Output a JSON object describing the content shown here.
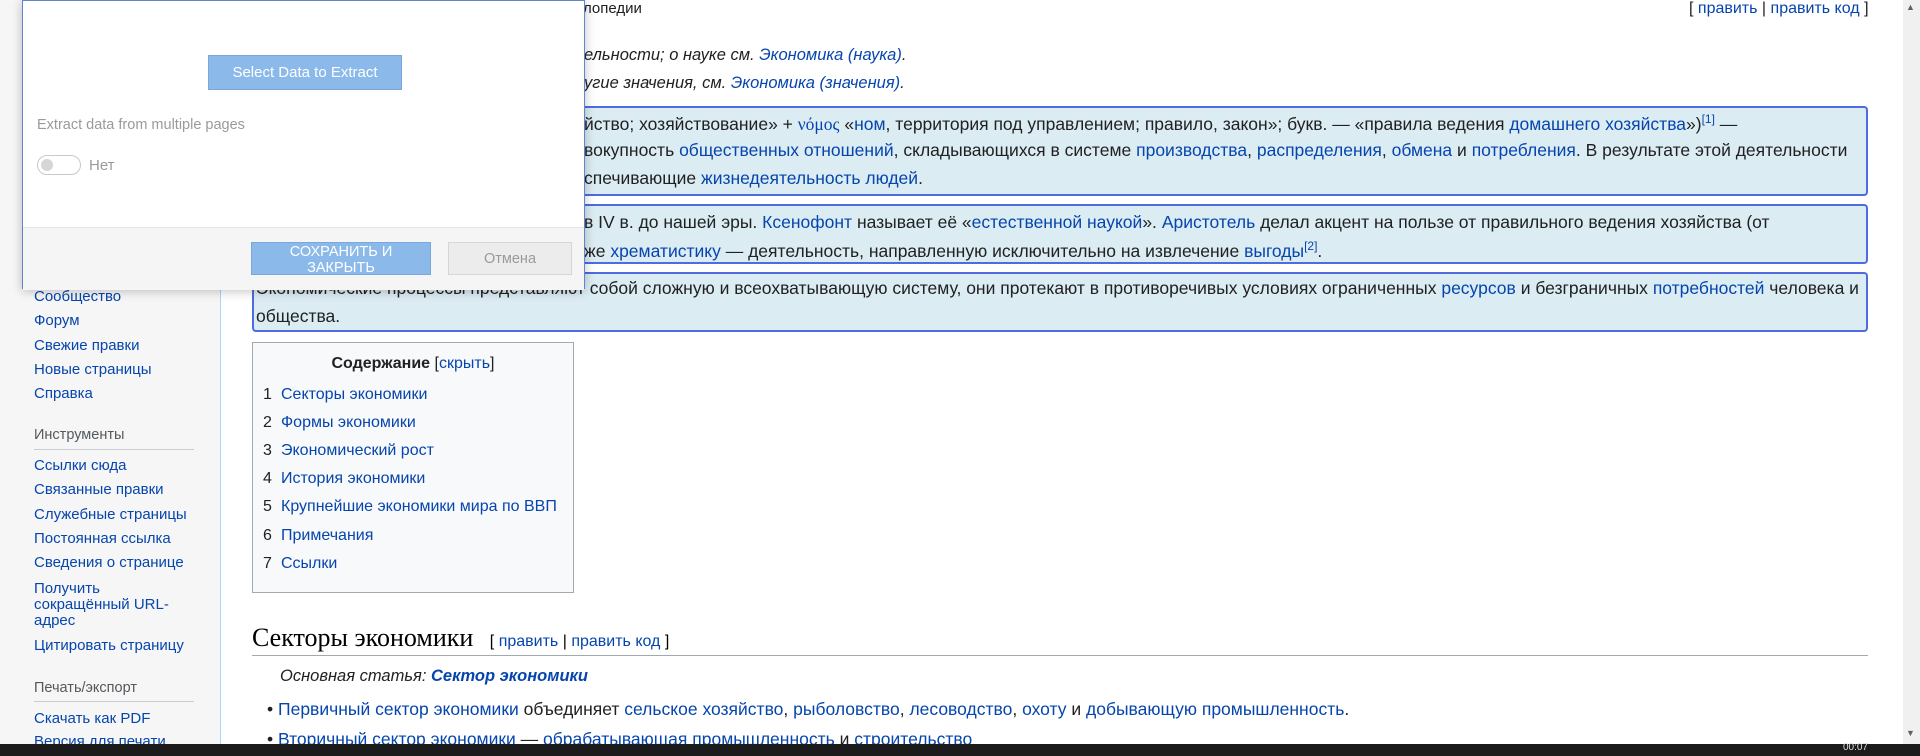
{
  "sidebar": {
    "participation_links": [
      "Сообщество",
      "Форум",
      "Свежие правки",
      "Новые страницы",
      "Справка"
    ],
    "tools_heading": "Инструменты",
    "tools_links": [
      "Ссылки сюда",
      "Связанные правки",
      "Служебные страницы",
      "Постоянная ссылка",
      "Сведения о странице"
    ],
    "short_url_lines": [
      "Получить",
      "сокращённый URL-",
      "адрес"
    ],
    "cite_link": "Цитировать страницу",
    "print_heading": "Печать/экспорт",
    "print_links": [
      "Скачать как PDF",
      "Версия для печати"
    ]
  },
  "article": {
    "subtitle_partial": "лопедии",
    "top_edit": {
      "open": "[",
      "edit": "править",
      "sep": "|",
      "edit_code": "править код",
      "close": "]"
    },
    "hatnote1": {
      "pre": "ельности; о науке см.",
      "link": "Экономика (наука)",
      "post": "."
    },
    "hatnote2": {
      "pre": "угие значения, см.",
      "link": "Экономика (значения)",
      "post": "."
    },
    "p1": {
      "l1_a": "йство; хозяйствование» +",
      "l1_greek": "νόμος",
      "l1_b": "«",
      "l1_link1": "ном",
      "l1_c": ", территория под управлением; правило, закон»; букв. — «правила ведения",
      "l1_link2": "домашнего хозяйства",
      "l1_d": "»)",
      "l1_sup": "[1]",
      "l1_e": " —",
      "l2_a": "вокупность",
      "l2_link1": "общественных отношений",
      "l2_b": ", складывающихся в системе",
      "l2_link2": "производства",
      "l2_c": ",",
      "l2_link3": "распределения",
      "l2_d": ",",
      "l2_link4": "обмена",
      "l2_e": "и",
      "l2_link5": "потребления",
      "l2_f": ". В результате этой деятельности",
      "l3_a": "спечивающие",
      "l3_link": "жизнедеятельность людей",
      "l3_b": "."
    },
    "p2": {
      "l1_a": "в IV в. до нашей эры.",
      "l1_link1": "Ксенофонт",
      "l1_b": "называет её «",
      "l1_link2": "естественной наукой",
      "l1_c": "».",
      "l1_link3": "Аристотель",
      "l1_d": "делал акцент на пользе от правильного ведения хозяйства (от",
      "l2_a": "же",
      "l2_link1": "хрематистику",
      "l2_b": "— деятельность, направленную исключительно на извлечение",
      "l2_link2": "выгоды",
      "l2_sup": "[2]",
      "l2_c": "."
    },
    "p3": {
      "l1_a": "Экономические процессы представляют собой сложную и всеохватывающую систему, они протекают в противоречивых условиях ограниченных",
      "l1_link1": "ресурсов",
      "l1_b": "и безграничных",
      "l1_link2": "потребностей",
      "l1_c": "человека и",
      "l2": "общества."
    },
    "toc": {
      "title": "Содержание",
      "toggle_open": "[",
      "toggle": "скрыть",
      "toggle_close": "]",
      "items": [
        {
          "num": "1",
          "label": "Секторы экономики"
        },
        {
          "num": "2",
          "label": "Формы экономики"
        },
        {
          "num": "3",
          "label": "Экономический рост"
        },
        {
          "num": "4",
          "label": "История экономики"
        },
        {
          "num": "5",
          "label": "Крупнейшие экономики мира по ВВП"
        },
        {
          "num": "6",
          "label": "Примечания"
        },
        {
          "num": "7",
          "label": "Ссылки"
        }
      ]
    },
    "section1": {
      "heading": "Секторы экономики",
      "edit": {
        "open": "[",
        "edit": "править",
        "sep": "|",
        "edit_code": "править код",
        "close": "]"
      },
      "main_article_label": "Основная статья:",
      "main_article_link": "Сектор экономики",
      "bullet1": {
        "link1": "Первичный сектор экономики",
        "a": "объединяет",
        "link2": "сельское хозяйство",
        "b": ",",
        "link3": "рыболовство",
        "c": ",",
        "link4": "лесоводство",
        "d": ",",
        "link5": "охоту",
        "e": "и",
        "link6": "добывающую промышленность",
        "f": "."
      },
      "bullet2": {
        "link1": "Вторичный сектор экономики",
        "a": "—",
        "link2": "обрабатывающая промышленность",
        "b": "и",
        "link3": "строительство"
      }
    }
  },
  "dialog": {
    "extract_button": "Select Data to Extract",
    "multi_pages_label": "Extract data from multiple pages",
    "toggle_label": "Нет",
    "save_button": "СОХРАНИТЬ И ЗАКРЫТЬ",
    "cancel_button": "Отмена"
  },
  "taskbar": {
    "clock": "00:07"
  },
  "colors": {
    "link": "#0645ad",
    "highlight_bg": "#dcecf3",
    "highlight_border": "#4f6be0",
    "button_blue": "#8bbaea"
  }
}
